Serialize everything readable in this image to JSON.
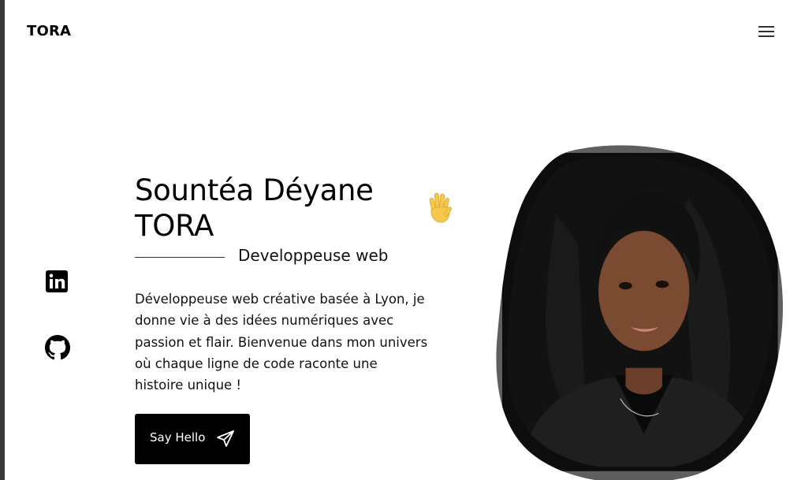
{
  "header": {
    "logo": "TORA",
    "menu_icon": "hamburger-menu-icon"
  },
  "socials": [
    {
      "name": "LinkedIn",
      "icon": "linkedin-icon"
    },
    {
      "name": "GitHub",
      "icon": "github-icon"
    }
  ],
  "hero": {
    "title_line1": "Sountéa Déyane",
    "title_line2": "TORA",
    "wave_icon": "waving-hand-emoji",
    "subtitle": "Developpeuse web",
    "bio_lines": [
      "Développeuse web créative basée à Lyon, je",
      "donne vie à des idées numériques avec",
      "passion et flair. Bienvenue dans mon univers",
      "où chaque ligne de code raconte une",
      "histoire unique !"
    ],
    "cta_label": "Say Hello",
    "cta_icon": "send-paper-plane-icon"
  },
  "portrait": {
    "alt_icon": "profile-photo"
  },
  "colors": {
    "text": "#000000",
    "button_bg": "#000000",
    "button_text": "#ffffff",
    "frame": "#5f5f5f",
    "wave": "#f5c84c"
  }
}
